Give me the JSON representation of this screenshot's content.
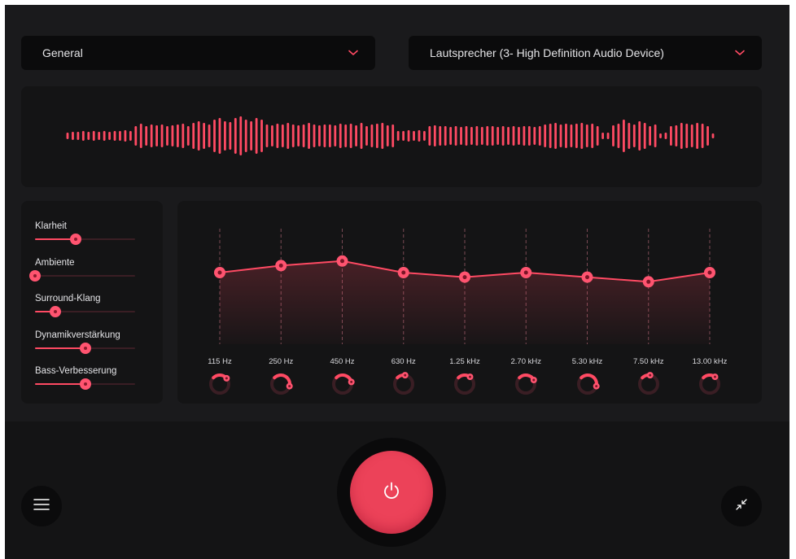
{
  "theme": {
    "accent": "#ff4a63",
    "background": "#141415",
    "panel": "#1a1a1c"
  },
  "preset_dropdown": {
    "label": "General",
    "icon": "chevron-down-icon"
  },
  "device_dropdown": {
    "label": "Lautsprecher (3- High Definition Audio Device)",
    "icon": "chevron-down-icon"
  },
  "waveform": {
    "bar_heights": [
      4,
      5,
      5,
      6,
      5,
      6,
      5,
      6,
      5,
      6,
      6,
      7,
      6,
      12,
      15,
      12,
      14,
      13,
      14,
      12,
      13,
      14,
      15,
      12,
      16,
      18,
      16,
      14,
      20,
      22,
      18,
      17,
      22,
      24,
      20,
      18,
      22,
      20,
      14,
      13,
      15,
      14,
      16,
      14,
      13,
      14,
      16,
      14,
      13,
      14,
      14,
      13,
      15,
      14,
      15,
      13,
      16,
      12,
      14,
      15,
      16,
      13,
      14,
      6,
      6,
      7,
      6,
      7,
      6,
      12,
      13,
      12,
      12,
      11,
      12,
      11,
      12,
      11,
      12,
      11,
      12,
      12,
      11,
      12,
      11,
      12,
      11,
      12,
      12,
      11,
      12,
      14,
      15,
      16,
      14,
      15,
      14,
      15,
      16,
      14,
      15,
      12,
      4,
      4,
      13,
      15,
      20,
      16,
      14,
      18,
      16,
      12,
      14,
      3,
      4,
      12,
      13,
      16,
      15,
      14,
      16,
      15,
      12,
      3
    ]
  },
  "sliders": [
    {
      "label": "Klarheit",
      "value": 0.41
    },
    {
      "label": "Ambiente",
      "value": 0.0
    },
    {
      "label": "Surround-Klang",
      "value": 0.2
    },
    {
      "label": "Dynamikverstärkung",
      "value": 0.5
    },
    {
      "label": "Bass-Verbesserung",
      "value": 0.5
    }
  ],
  "equalizer": {
    "gains": [
      0.62,
      0.68,
      0.72,
      0.62,
      0.58,
      0.62,
      0.58,
      0.54,
      0.62
    ],
    "bands": [
      {
        "label": "115 Hz",
        "knob": 0.35
      },
      {
        "label": "250 Hz",
        "knob": 0.55
      },
      {
        "label": "450 Hz",
        "knob": 0.45
      },
      {
        "label": "630 Hz",
        "knob": 0.2
      },
      {
        "label": "1.25 kHz",
        "knob": 0.3
      },
      {
        "label": "2.70 kHz",
        "knob": 0.4
      },
      {
        "label": "5.30 kHz",
        "knob": 0.55
      },
      {
        "label": "7.50 kHz",
        "knob": 0.2
      },
      {
        "label": "13.00 kHz",
        "knob": 0.3
      }
    ]
  },
  "controls": {
    "menu_icon": "hamburger-menu-icon",
    "power_icon": "power-icon",
    "minimize_icon": "minimize-arrows-icon"
  }
}
